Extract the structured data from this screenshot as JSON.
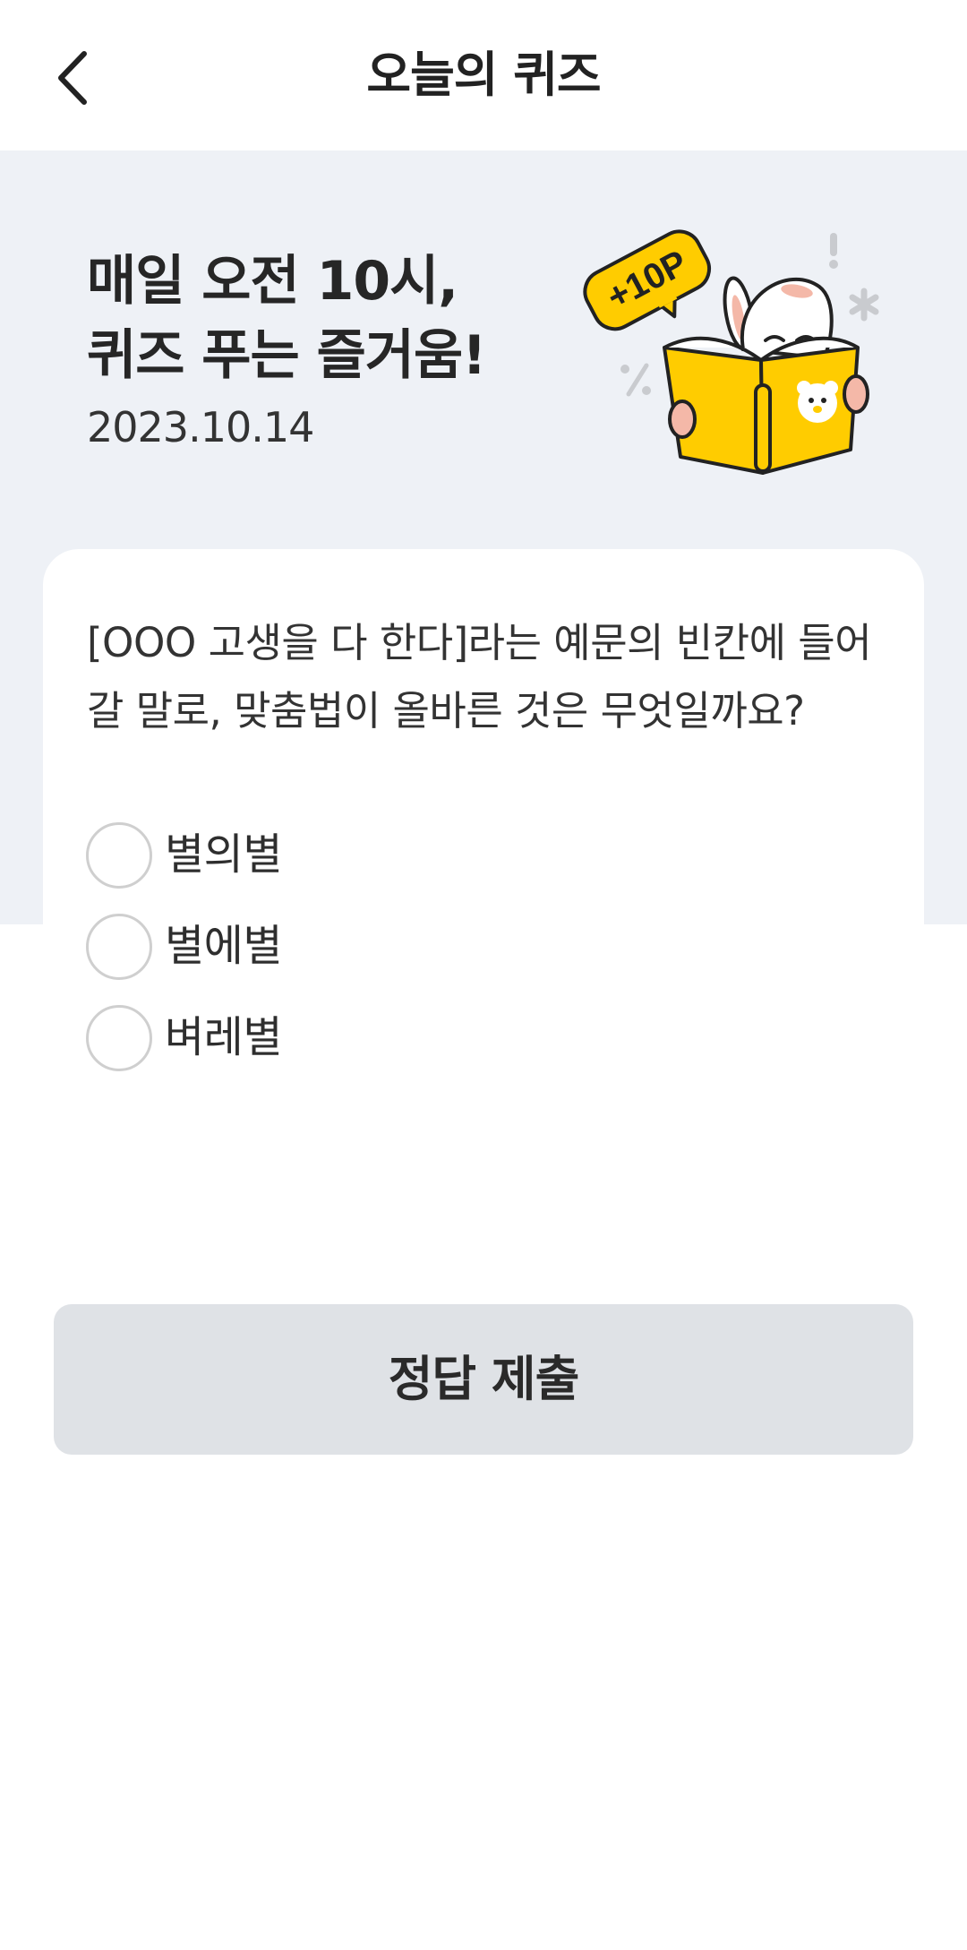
{
  "header": {
    "title": "오늘의 퀴즈",
    "back_icon": "chevron-left-icon"
  },
  "hero": {
    "line1": "매일 오전 10시,",
    "line2": "퀴즈 푸는 즐거움!",
    "date": "2023.10.14",
    "badge_text": "+10P",
    "background_color": "#eef1f6"
  },
  "quiz": {
    "question": "[OOO 고생을 다 한다]라는 예문의 빈칸에 들어갈 말로, 맞춤법이 올바른 것은 무엇일까요?",
    "options": [
      {
        "label": "별의별",
        "selected": false
      },
      {
        "label": "별에별",
        "selected": false
      },
      {
        "label": "벼레별",
        "selected": false
      }
    ]
  },
  "submit": {
    "label": "정답 제출",
    "color": "#dfe2e6"
  },
  "colors": {
    "accent_yellow": "#ffcc00"
  }
}
